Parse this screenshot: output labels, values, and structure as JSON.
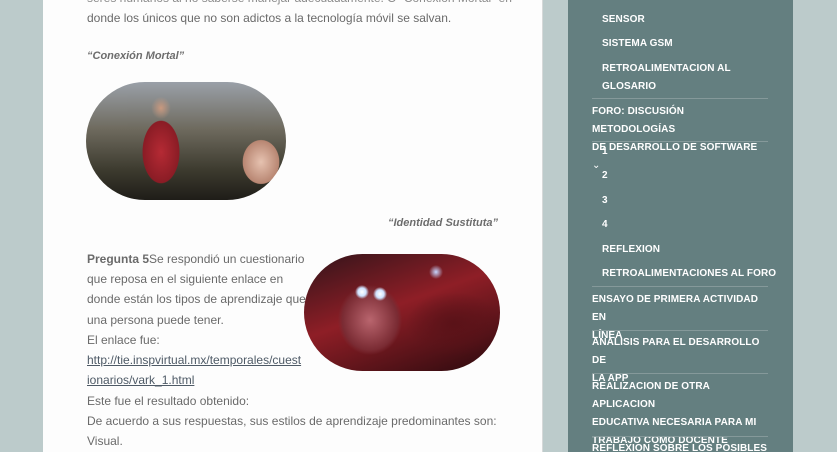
{
  "article": {
    "intro_line": "donde los únicos que no son adictos a la tecnología móvil se salvan.",
    "caption1": "“Conexión Mortal”",
    "caption2": "“Identidad Sustituta”",
    "question_label": "Pregunta 5",
    "question_lines": [
      "Se respondió un cuestionario",
      "que reposa en el siguiente enlace en",
      "donde están los tipos de aprendizaje que",
      "una persona puede tener.",
      "El enlace fue:"
    ],
    "link_lines": [
      "http://tie.inspvirtual.mx/temporales/cuest",
      "ionarios/vark_1.html"
    ],
    "result_lines": [
      "Este fue el resultado obtenido:",
      "De acuerdo a sus respuestas, sus estilos de aprendizaje predominantes son:",
      "Visual."
    ],
    "image1_alt": "escena Conexión Mortal",
    "image2_alt": "escena Identidad Sustituta"
  },
  "sidebar": {
    "sub_items_a": [
      "SENSOR",
      "SISTEMA GSM",
      "RETROALIMENTACION AL",
      "GLOSARIO"
    ],
    "foro_lines": [
      "FORO: DISCUSIÓN METODOLOGÍAS",
      "DE DESARROLLO DE SOFTWARE"
    ],
    "foro_chevron": "⌄",
    "sub_items_b": [
      "1",
      "2",
      "3",
      "4",
      "REFLEXION",
      "RETROALIMENTACIONES AL FORO"
    ],
    "ensayo_lines": [
      "ENSAYO DE PRIMERA ACTIVIDAD EN",
      "LÍNEA"
    ],
    "analisis_lines": [
      "ANALISIS PARA EL DESARROLLO DE",
      "LA APP"
    ],
    "realizacion_lines": [
      "REALIZACION DE OTRA APLICACION",
      "EDUCATIVA NECESARIA PARA MI",
      "TRABAJO COMO DOCENTE"
    ],
    "reflexion_line": "REFLEXION SOBRE LOS POSIBLES"
  }
}
